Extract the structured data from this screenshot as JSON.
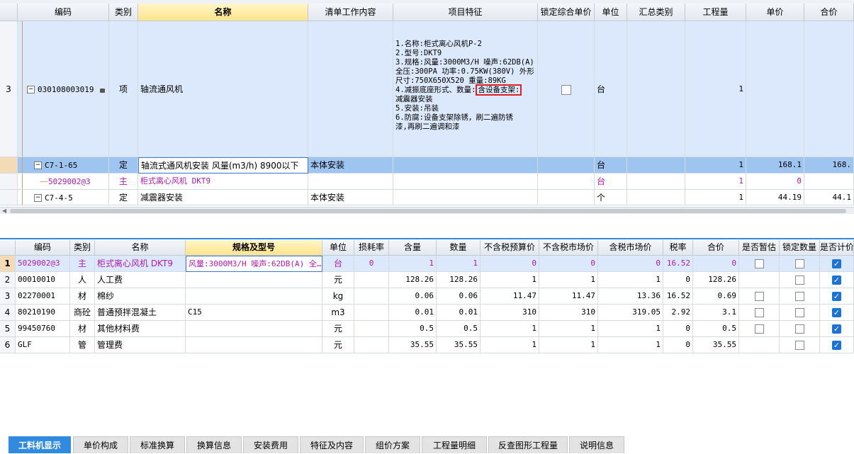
{
  "top_table": {
    "headers": [
      "编码",
      "类别",
      "名称",
      "清单工作内容",
      "项目特征",
      "锁定综合单价",
      "单位",
      "汇总类别",
      "工程量",
      "单价",
      "合价"
    ],
    "item_row": {
      "num": "3",
      "code": "030108003019",
      "type": "项",
      "name": "轴流通风机",
      "features": [
        "1.名称:柜式离心风机P-2",
        "2.型号:DKT9",
        "3.规格:风量:3000M3/H 噪声:62DB(A)",
        "全压:300PA 功率:0.75KW(380V) 外形",
        "尺寸:750X650X520 重量:89KG",
        "4.减振底座形式、数量:",
        "减震器安装",
        "5.安装:吊装",
        "6.防腐:设备支架除锈，刷二遍防锈",
        "漆,再刷二遍调和漆"
      ],
      "features_highlight": "含设备支架:",
      "unit": "台",
      "qty": "1"
    },
    "sub_rows": [
      {
        "code": "C7-1-65",
        "type": "定",
        "name": "轴流式通风机安装 风量(m3/h) 8900以下",
        "work": "本体安装",
        "unit": "台",
        "qty": "1",
        "price": "168.1",
        "total": "168."
      },
      {
        "code": "5029002@3",
        "type": "主",
        "name": "柜式离心风机 DKT9",
        "work": "",
        "unit": "台",
        "qty": "1",
        "price": "0",
        "total": ""
      },
      {
        "code": "C7-4-5",
        "type": "定",
        "name": "减震器安装",
        "work": "本体安装",
        "unit": "个",
        "qty": "1",
        "price": "44.19",
        "total": "44.1"
      }
    ]
  },
  "tabs": [
    "工料机显示",
    "单价构成",
    "标准换算",
    "换算信息",
    "安装费用",
    "特征及内容",
    "组价方案",
    "工程量明细",
    "反查图形工程量",
    "说明信息"
  ],
  "bottom_table": {
    "headers": [
      "编码",
      "类别",
      "名称",
      "规格及型号",
      "单位",
      "损耗率",
      "含量",
      "数量",
      "不含税预算价",
      "不含税市场价",
      "含税市场价",
      "税率",
      "合价",
      "是否暂估",
      "锁定数量",
      "是否计价"
    ],
    "rows": [
      {
        "num": "1",
        "code": "5029002@3",
        "type": "主",
        "name": "柜式离心风机 DKT9",
        "spec": "风量:3000M3/H 噪声:62DB(A) 全…",
        "unit": "台",
        "loss": "0",
        "content": "1",
        "qty": "1",
        "pre": "0",
        "mkt": "0",
        "tax_mkt": "0",
        "rate": "16.52",
        "total": "0",
        "est": false,
        "lock": false,
        "calc": true
      },
      {
        "num": "2",
        "code": "00010010",
        "type": "人",
        "name": "人工费",
        "spec": "",
        "unit": "元",
        "loss": "",
        "content": "128.26",
        "qty": "128.26",
        "pre": "1",
        "mkt": "1",
        "tax_mkt": "1",
        "rate": "0",
        "total": "128.26",
        "est": null,
        "lock": false,
        "calc": true
      },
      {
        "num": "3",
        "code": "02270001",
        "type": "材",
        "name": "棉纱",
        "spec": "",
        "unit": "kg",
        "loss": "",
        "content": "0.06",
        "qty": "0.06",
        "pre": "11.47",
        "mkt": "11.47",
        "tax_mkt": "13.36",
        "rate": "16.52",
        "total": "0.69",
        "est": false,
        "lock": false,
        "calc": true
      },
      {
        "num": "4",
        "code": "80210190",
        "type": "商砼",
        "name": "普通预拌混凝土",
        "spec": "C15",
        "unit": "m3",
        "loss": "",
        "content": "0.01",
        "qty": "0.01",
        "pre": "310",
        "mkt": "310",
        "tax_mkt": "319.05",
        "rate": "2.92",
        "total": "3.1",
        "est": false,
        "lock": false,
        "calc": true
      },
      {
        "num": "5",
        "code": "99450760",
        "type": "材",
        "name": "其他材料费",
        "spec": "",
        "unit": "元",
        "loss": "",
        "content": "0.5",
        "qty": "0.5",
        "pre": "1",
        "mkt": "1",
        "tax_mkt": "1",
        "rate": "0",
        "total": "0.5",
        "est": false,
        "lock": false,
        "calc": true
      },
      {
        "num": "6",
        "code": "GLF",
        "type": "管",
        "name": "管理费",
        "spec": "",
        "unit": "元",
        "loss": "",
        "content": "35.55",
        "qty": "35.55",
        "pre": "1",
        "mkt": "1",
        "tax_mkt": "1",
        "rate": "0",
        "total": "35.55",
        "est": null,
        "lock": false,
        "calc": true
      }
    ]
  }
}
